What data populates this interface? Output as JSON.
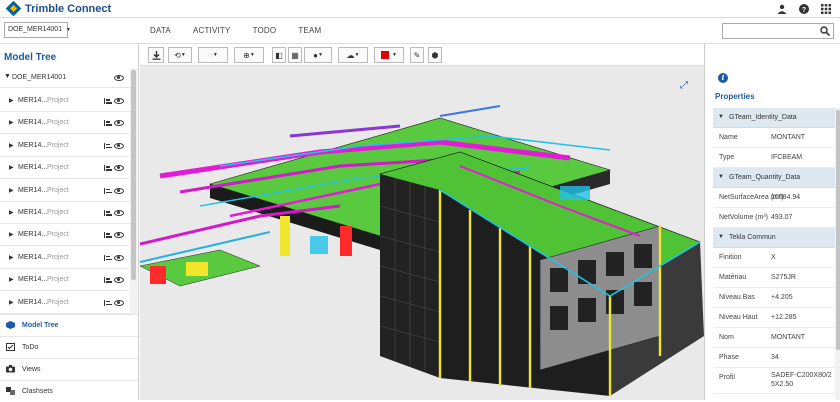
{
  "app": {
    "title": "Trimble Connect"
  },
  "top_icons": [
    "user-icon",
    "help-icon",
    "apps-grid-icon"
  ],
  "project": {
    "selected": "DOE_MER14001"
  },
  "nav": {
    "tabs": [
      "DATA",
      "ACTIVITY",
      "TODO",
      "TEAM"
    ]
  },
  "search": {
    "value": ""
  },
  "model_tree": {
    "title": "Model Tree",
    "root": "DOE_MER14001",
    "items": [
      {
        "name": "MER14...",
        "kind": "Project"
      },
      {
        "name": "MER14...",
        "kind": "Project"
      },
      {
        "name": "MER14...",
        "kind": "Project"
      },
      {
        "name": "MER14...",
        "kind": "Project"
      },
      {
        "name": "MER14...",
        "kind": "Project"
      },
      {
        "name": "MER14...",
        "kind": "Project"
      },
      {
        "name": "MER14...",
        "kind": "Project"
      },
      {
        "name": "MER14...",
        "kind": "Project"
      },
      {
        "name": "MER14...",
        "kind": "Project"
      },
      {
        "name": "MER14...",
        "kind": "Project"
      }
    ]
  },
  "bottom_nav": [
    {
      "label": "Model Tree",
      "icon": "cube-icon",
      "active": true
    },
    {
      "label": "ToDo",
      "icon": "todo-icon",
      "active": false
    },
    {
      "label": "Views",
      "icon": "camera-icon",
      "active": false
    },
    {
      "label": "Clashsets",
      "icon": "clash-icon",
      "active": false
    }
  ],
  "properties": {
    "title": "Properties",
    "sections": [
      {
        "title": "GTeam_Identity_Data",
        "rows": [
          [
            "Name",
            "MONTANT"
          ],
          [
            "Type",
            "IFCBEAM"
          ]
        ]
      },
      {
        "title": "GTeam_Quantity_Data",
        "rows": [
          [
            "NetSurfaceArea (m²)",
            "10084.94"
          ],
          [
            "NetVolume (m³)",
            "493.07"
          ]
        ]
      },
      {
        "title": "Tekla Commun",
        "rows": [
          [
            "Finition",
            "X"
          ],
          [
            "Matériau",
            "S275JR"
          ],
          [
            "Niveau Bas",
            "+4.205"
          ],
          [
            "Niveau Haut",
            "+12.285"
          ],
          [
            "Nom",
            "MONTANT"
          ],
          [
            "Phase",
            "34"
          ],
          [
            "Profil",
            "SADEF-C200X80/25X2.50"
          ]
        ]
      }
    ]
  },
  "colors": {
    "accent": "#1c5aa6",
    "section_bg": "#dde8f1",
    "viewport_bg": "#e9e9e9"
  }
}
